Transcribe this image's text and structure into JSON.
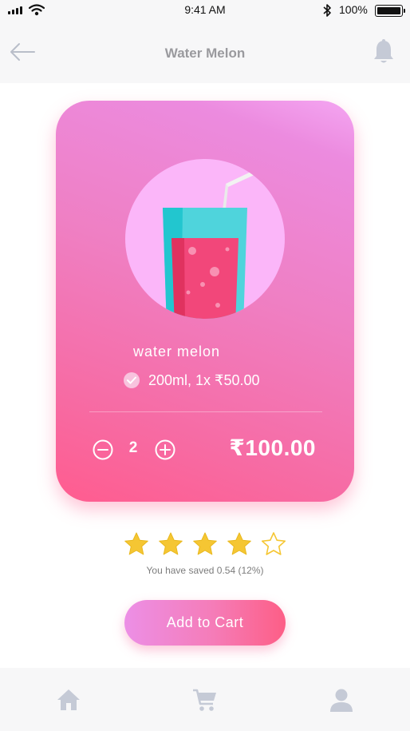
{
  "status_bar": {
    "time": "9:41 AM",
    "battery": "100%"
  },
  "header": {
    "title": "Water Melon"
  },
  "product": {
    "name": "water melon",
    "variant": "200ml, 1x ₹50.00",
    "quantity": "2",
    "total": "₹100.00"
  },
  "rating": {
    "value": 4,
    "max": 5,
    "saved_text": "You have saved 0.54 (12%)"
  },
  "cart_button": {
    "label": "Add to Cart"
  },
  "colors": {
    "accent_pink": "#ff5c8f",
    "card_light": "#f4a6f2",
    "star_gold": "#f5c633",
    "icon_gray": "#c5cad6"
  },
  "icons": [
    "back-arrow-icon",
    "bell-icon",
    "check-icon",
    "minus-icon",
    "plus-icon",
    "star-icon",
    "home-icon",
    "cart-icon",
    "user-icon"
  ]
}
